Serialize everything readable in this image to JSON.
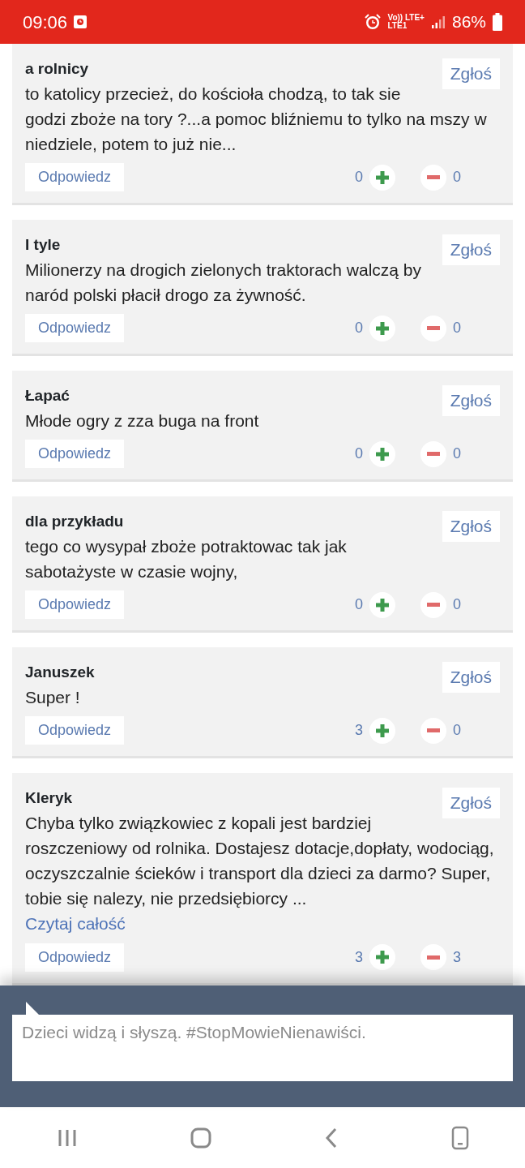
{
  "status_bar": {
    "time": "09:06",
    "network_top": "Vo)) LTE+",
    "network_bottom": "LTE1",
    "battery": "86%"
  },
  "comments": [
    {
      "author": "a rolnicy",
      "text": "to katolicy przecież, do kościoła chodzą, to tak sie godzi zboże na tory ?...a pomoc bliźniemu to tylko na mszy w niedziele, potem to już nie...",
      "report": "Zgłoś",
      "reply": "Odpowiedz",
      "likes": "0",
      "dislikes": "0"
    },
    {
      "author": "I tyle",
      "text": "Milionerzy na drogich zielonych traktorach walczą by naród polski płacił drogo za żywność.",
      "report": "Zgłoś",
      "reply": "Odpowiedz",
      "likes": "0",
      "dislikes": "0"
    },
    {
      "author": "Łapać",
      "text": "Młode ogry z zza buga na front",
      "report": "Zgłoś",
      "reply": "Odpowiedz",
      "likes": "0",
      "dislikes": "0"
    },
    {
      "author": "dla przykładu",
      "text": "tego co wysypał zboże potraktowac tak jak sabotażyste w czasie wojny,",
      "report": "Zgłoś",
      "reply": "Odpowiedz",
      "likes": "0",
      "dislikes": "0"
    },
    {
      "author": "Januszek",
      "text": "Super !",
      "report": "Zgłoś",
      "reply": "Odpowiedz",
      "likes": "3",
      "dislikes": "0"
    },
    {
      "author": "Kleryk",
      "text": "Chyba tylko związkowiec z kopali jest bardziej roszczeniowy od rolnika. Dostajesz dotacje,dopłaty, wodociąg, oczyszczalnie ścieków i transport dla dzieci za darmo? Super, tobie się nalezy, nie przedsiębiorcy ...",
      "read_more": "Czytaj całość",
      "report": "Zgłoś",
      "reply": "Odpowiedz",
      "likes": "3",
      "dislikes": "3"
    }
  ],
  "composer": {
    "placeholder": "Dzieci widzą i słyszą. #StopMowieNienawiści."
  }
}
